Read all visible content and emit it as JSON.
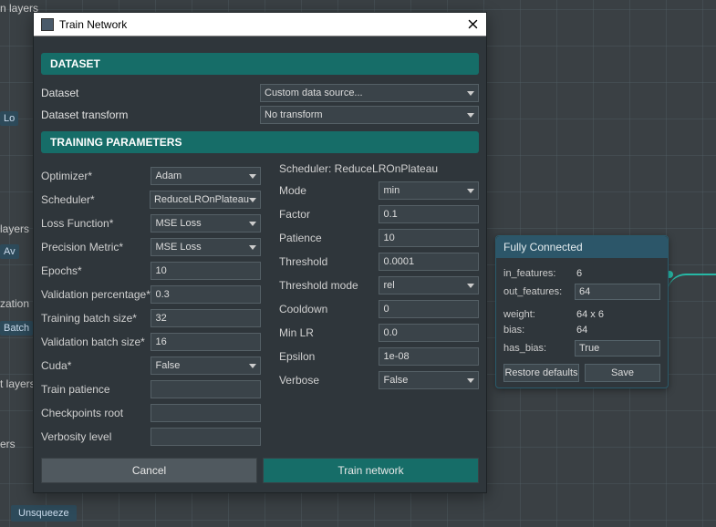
{
  "background": {
    "tree_fragments": {
      "top": "n layers",
      "layers": "layers",
      "av": "Av",
      "zation": "zation",
      "batch": "Batch",
      "t_lay": "t layers",
      "ers": "ers",
      "lo": "Lo"
    },
    "bottom_chip": "Unsqueeze"
  },
  "dialog": {
    "title": "Train Network",
    "sections": {
      "dataset": "DATASET",
      "training": "TRAINING PARAMETERS"
    },
    "dataset": {
      "dataset_label": "Dataset",
      "dataset_value": "Custom data source...",
      "transform_label": "Dataset transform",
      "transform_value": "No transform"
    },
    "left": {
      "optimizer_label": "Optimizer*",
      "optimizer_value": "Adam",
      "scheduler_label": "Scheduler*",
      "scheduler_value": "ReduceLROnPlateau",
      "loss_label": "Loss Function*",
      "loss_value": "MSE Loss",
      "precision_label": "Precision Metric*",
      "precision_value": "MSE Loss",
      "epochs_label": "Epochs*",
      "epochs_value": "10",
      "valpct_label": "Validation percentage*",
      "valpct_value": "0.3",
      "trainbs_label": "Training batch size*",
      "trainbs_value": "32",
      "valbs_label": "Validation batch size*",
      "valbs_value": "16",
      "cuda_label": "Cuda*",
      "cuda_value": "False",
      "trainpat_label": "Train patience",
      "trainpat_value": "",
      "ckpt_label": "Checkpoints root",
      "ckpt_value": "",
      "verb_label": "Verbosity level",
      "verb_value": ""
    },
    "right": {
      "title": "Scheduler: ReduceLROnPlateau",
      "mode_label": "Mode",
      "mode_value": "min",
      "factor_label": "Factor",
      "factor_value": "0.1",
      "patience_label": "Patience",
      "patience_value": "10",
      "threshold_label": "Threshold",
      "threshold_value": "0.0001",
      "thrmode_label": "Threshold mode",
      "thrmode_value": "rel",
      "cooldown_label": "Cooldown",
      "cooldown_value": "0",
      "minlr_label": "Min LR",
      "minlr_value": "0.0",
      "eps_label": "Epsilon",
      "eps_value": "1e-08",
      "verbose_label": "Verbose",
      "verbose_value": "False"
    },
    "buttons": {
      "cancel": "Cancel",
      "train": "Train network"
    }
  },
  "prop_panel": {
    "title": "Fully Connected",
    "in_features_k": "in_features:",
    "in_features_v": "6",
    "out_features_k": "out_features:",
    "out_features_v": "64",
    "weight_k": "weight:",
    "weight_v": "64 x 6",
    "bias_k": "bias:",
    "bias_v": "64",
    "has_bias_k": "has_bias:",
    "has_bias_v": "True",
    "restore": "Restore defaults",
    "save": "Save"
  }
}
